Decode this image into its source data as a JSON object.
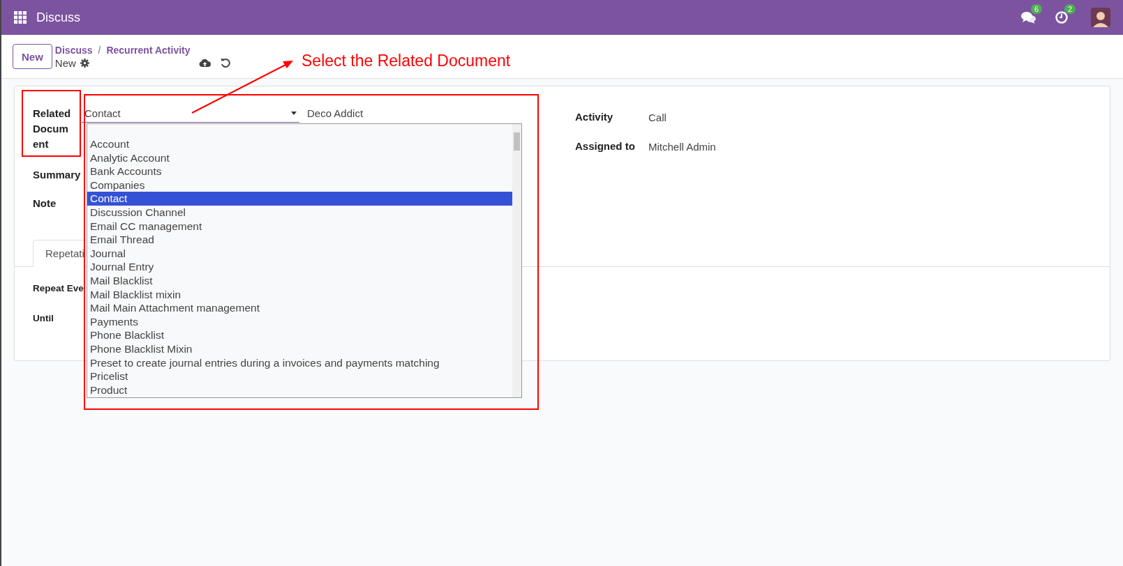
{
  "topbar": {
    "app_title": "Discuss",
    "messages_badge": "6",
    "activities_badge": "2"
  },
  "control_panel": {
    "new_button": "New",
    "breadcrumb": [
      {
        "label": "Discuss"
      },
      {
        "label": "Recurrent Activity"
      }
    ],
    "separator": "/",
    "record": "New"
  },
  "annotation": {
    "text": "Select the Related Document"
  },
  "form": {
    "related_document": {
      "label": "Related Document",
      "model": "Contact",
      "record": "Deco Addict"
    },
    "left_fields": [
      {
        "label": "Summary"
      },
      {
        "label": "Note"
      }
    ],
    "right_fields": [
      {
        "label": "Activity",
        "value": "Call"
      },
      {
        "label": "Assigned to",
        "value": "Mitchell Admin"
      }
    ],
    "tabs": [
      {
        "label": "Repetati",
        "selected": true
      }
    ],
    "tab_fields": [
      {
        "label": "Repeat Eve"
      },
      {
        "label": "Until"
      }
    ]
  },
  "dropdown": {
    "options": [
      {
        "label": "Account",
        "selected": false
      },
      {
        "label": "Analytic Account",
        "selected": false
      },
      {
        "label": "Bank Accounts",
        "selected": false
      },
      {
        "label": "Companies",
        "selected": false
      },
      {
        "label": "Contact",
        "selected": true
      },
      {
        "label": "Discussion Channel",
        "selected": false
      },
      {
        "label": "Email CC management",
        "selected": false
      },
      {
        "label": "Email Thread",
        "selected": false
      },
      {
        "label": "Journal",
        "selected": false
      },
      {
        "label": "Journal Entry",
        "selected": false
      },
      {
        "label": "Mail Blacklist",
        "selected": false
      },
      {
        "label": "Mail Blacklist mixin",
        "selected": false
      },
      {
        "label": "Mail Main Attachment management",
        "selected": false
      },
      {
        "label": "Payments",
        "selected": false
      },
      {
        "label": "Phone Blacklist",
        "selected": false
      },
      {
        "label": "Phone Blacklist Mixin",
        "selected": false
      },
      {
        "label": "Preset to create journal entries during a invoices and payments matching",
        "selected": false
      },
      {
        "label": "Pricelist",
        "selected": false
      },
      {
        "label": "Product",
        "selected": false
      }
    ]
  }
}
